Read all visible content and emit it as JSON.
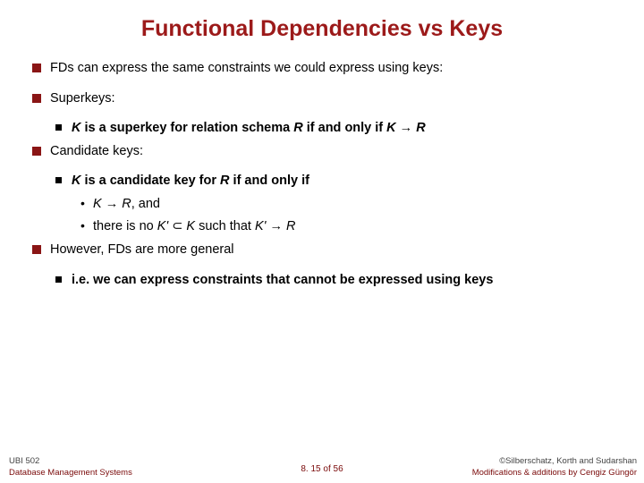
{
  "title": "Functional Dependencies vs Keys",
  "bullets": {
    "b1": "FDs can express the same constraints we could express using keys:",
    "b2": "Superkeys:",
    "b2_1a": "K",
    "b2_1b": " is a superkey for relation schema ",
    "b2_1c": "R",
    "b2_1d": " if and only if ",
    "b2_1e": "K",
    "b2_1f": " → ",
    "b2_1g": "R",
    "b3": "Candidate keys:",
    "b3_1a": "K",
    "b3_1b": " is a candidate key for ",
    "b3_1c": "R",
    "b3_1d": " if and only if",
    "b3_1_1a": "K",
    "b3_1_1b": " → ",
    "b3_1_1c": "R",
    "b3_1_1d": ", and",
    "b3_1_2a": "there is no ",
    "b3_1_2b": "K' ",
    "b3_1_2c": "⊂ ",
    "b3_1_2d": "K",
    "b3_1_2e": " such that ",
    "b3_1_2f": "K'",
    "b3_1_2g": " → ",
    "b3_1_2h": "R",
    "b4": "However, FDs are more general",
    "b4_1": "i.e. we can express constraints that cannot be expressed using keys"
  },
  "footer": {
    "course": "UBI 502",
    "copyright": "©Silberschatz, Korth and Sudarshan",
    "subject": "Database Management Systems",
    "page": "8. 15 of 56",
    "mods": "Modifications & additions by Cengiz Güngör"
  }
}
